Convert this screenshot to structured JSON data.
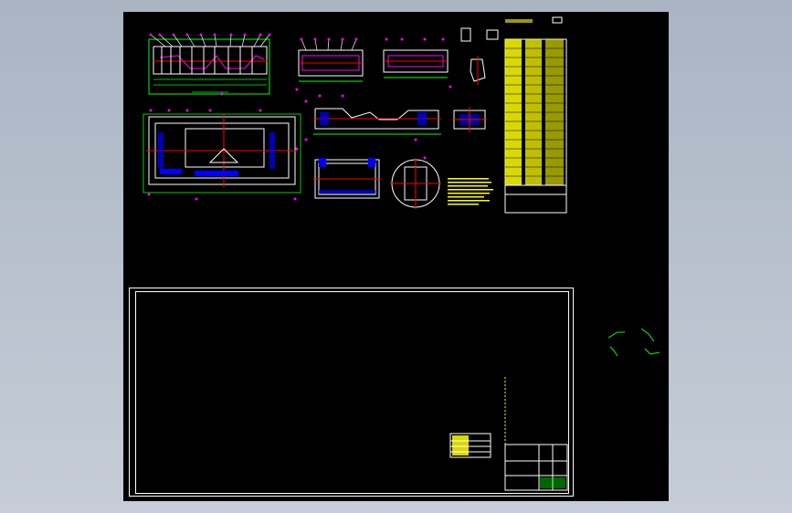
{
  "window": {
    "viewport_name": "cad-model-space"
  },
  "colors": {
    "background": "#000000",
    "outer_gray": "#b3bccb",
    "geometry": "#ffffff",
    "dimension": "#00ff00",
    "leader": "#ff00ff",
    "centerline": "#ff0000",
    "hidden": "#0000ff",
    "table_fill": "#ffff00",
    "annotation": "#00ffff"
  }
}
